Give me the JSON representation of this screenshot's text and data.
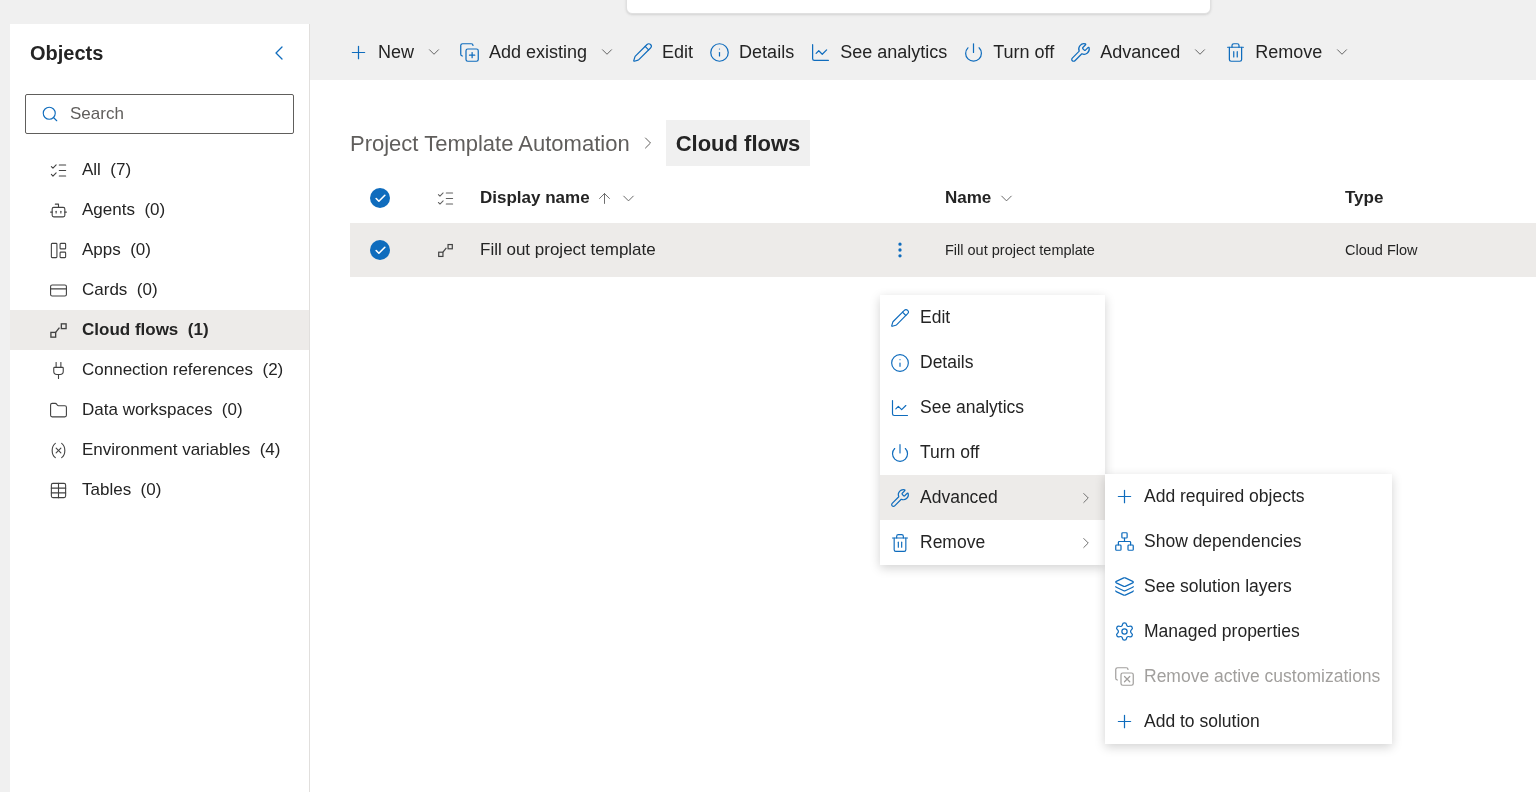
{
  "sidebar": {
    "title": "Objects",
    "search": {
      "placeholder": "Search"
    },
    "items": [
      {
        "label": "All",
        "count": "(7)",
        "kind": "list",
        "selected": false
      },
      {
        "label": "Agents",
        "count": "(0)",
        "kind": "bot",
        "selected": false
      },
      {
        "label": "Apps",
        "count": "(0)",
        "kind": "apps",
        "selected": false
      },
      {
        "label": "Cards",
        "count": "(0)",
        "kind": "card",
        "selected": false
      },
      {
        "label": "Cloud flows",
        "count": "(1)",
        "kind": "flow",
        "selected": true
      },
      {
        "label": "Connection references",
        "count": "(2)",
        "kind": "plug",
        "selected": false
      },
      {
        "label": "Data workspaces",
        "count": "(0)",
        "kind": "folder",
        "selected": false
      },
      {
        "label": "Environment variables",
        "count": "(4)",
        "kind": "variable",
        "selected": false
      },
      {
        "label": "Tables",
        "count": "(0)",
        "kind": "table",
        "selected": false
      }
    ]
  },
  "toolbar": [
    {
      "label": "New",
      "kind": "plus",
      "dropdown": true
    },
    {
      "label": "Add existing",
      "kind": "add-existing",
      "dropdown": true
    },
    {
      "label": "Edit",
      "kind": "edit",
      "dropdown": false
    },
    {
      "label": "Details",
      "kind": "info",
      "dropdown": false
    },
    {
      "label": "See analytics",
      "kind": "chart",
      "dropdown": false
    },
    {
      "label": "Turn off",
      "kind": "power",
      "dropdown": false
    },
    {
      "label": "Advanced",
      "kind": "tools",
      "dropdown": true
    },
    {
      "label": "Remove",
      "kind": "trash",
      "dropdown": true
    }
  ],
  "breadcrumb": [
    {
      "label": "Project Template Automation",
      "selected": false
    },
    {
      "label": "Cloud flows",
      "selected": true
    }
  ],
  "table": {
    "select_all_checked": true,
    "columns": [
      {
        "label": "Display name",
        "sorted": true,
        "dropdown": true
      },
      {
        "label": "Name",
        "sorted": false,
        "dropdown": true
      },
      {
        "label": "Type",
        "sorted": false,
        "dropdown": false
      }
    ],
    "rows": [
      {
        "selected": true,
        "display_name": "Fill out project template",
        "name": "Fill out project template",
        "type": "Cloud Flow"
      }
    ]
  },
  "context_menu": {
    "items": [
      {
        "label": "Edit",
        "kind": "edit",
        "submenu": false,
        "selected": false
      },
      {
        "label": "Details",
        "kind": "info",
        "submenu": false,
        "selected": false
      },
      {
        "label": "See analytics",
        "kind": "chart",
        "submenu": false,
        "selected": false
      },
      {
        "label": "Turn off",
        "kind": "power",
        "submenu": false,
        "selected": false
      },
      {
        "label": "Advanced",
        "kind": "tools",
        "submenu": true,
        "selected": true
      },
      {
        "label": "Remove",
        "kind": "trash",
        "submenu": true,
        "selected": false
      }
    ]
  },
  "submenu": {
    "items": [
      {
        "label": "Add required objects",
        "kind": "plus",
        "disabled": false
      },
      {
        "label": "Show dependencies",
        "kind": "tree",
        "disabled": false
      },
      {
        "label": "See solution layers",
        "kind": "layers",
        "disabled": false
      },
      {
        "label": "Managed properties",
        "kind": "gear",
        "disabled": false
      },
      {
        "label": "Remove active customizations",
        "kind": "remove-custom",
        "disabled": true
      },
      {
        "label": "Add to solution",
        "kind": "plus",
        "disabled": false
      }
    ]
  }
}
